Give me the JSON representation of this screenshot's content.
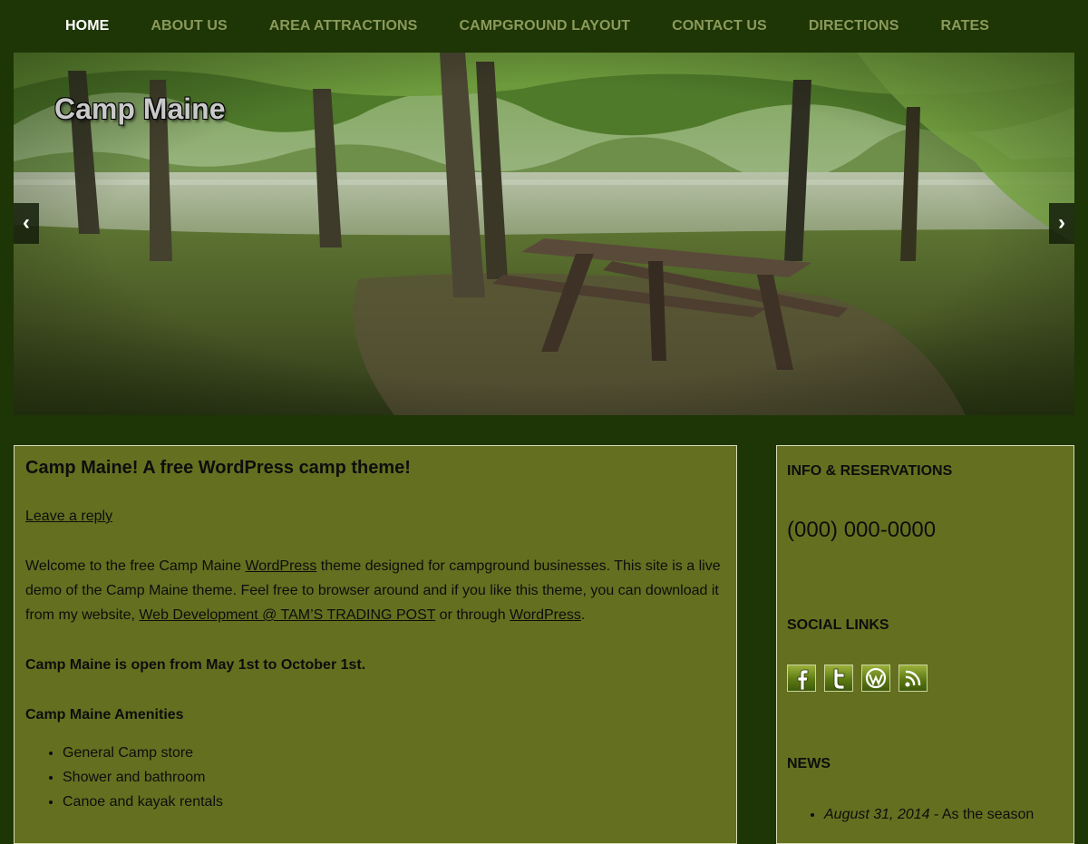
{
  "nav": {
    "items": [
      {
        "label": "HOME",
        "active": true
      },
      {
        "label": "ABOUT US"
      },
      {
        "label": "AREA ATTRACTIONS"
      },
      {
        "label": "CAMPGROUND LAYOUT"
      },
      {
        "label": "CONTACT US"
      },
      {
        "label": "DIRECTIONS"
      },
      {
        "label": "RATES"
      }
    ]
  },
  "hero": {
    "site_title": "Camp Maine",
    "prev_label": "‹",
    "next_label": "›"
  },
  "post": {
    "title": "Camp Maine! A free WordPress camp theme!",
    "leave_reply": "Leave a reply",
    "intro_1": "Welcome to the free Camp Maine ",
    "link_wordpress": "WordPress",
    "intro_2": " theme designed for campground businesses. This site is a live demo of the Camp Maine theme. Feel free to browser around and if you like this theme, you can download it from my website, ",
    "link_webdev": "Web Development @ TAM’S TRADING POST",
    "intro_3": " or through ",
    "link_wordpress_2": "WordPress",
    "intro_4": ".",
    "open_dates": "Camp Maine is open from May 1st to October 1st.",
    "amenities_heading": "Camp Maine Amenities",
    "amenities": [
      "General Camp store",
      "Shower and bathroom",
      "Canoe and kayak rentals"
    ]
  },
  "sidebar": {
    "info_title": "INFO & RESERVATIONS",
    "phone": "(000) 000-0000",
    "social_title": "SOCIAL LINKS",
    "social_icons": [
      "facebook-icon",
      "twitter-icon",
      "wordpress-icon",
      "rss-icon"
    ],
    "news_title": "NEWS",
    "news": [
      {
        "date": "August 31, 2014",
        "text": " - As the season"
      }
    ]
  },
  "colors": {
    "page_background": "#1e3505",
    "panel_background": "#647020",
    "nav_text": "#8b9a5b",
    "nav_active": "#ffffff",
    "panel_border": "#d6dbb8"
  }
}
